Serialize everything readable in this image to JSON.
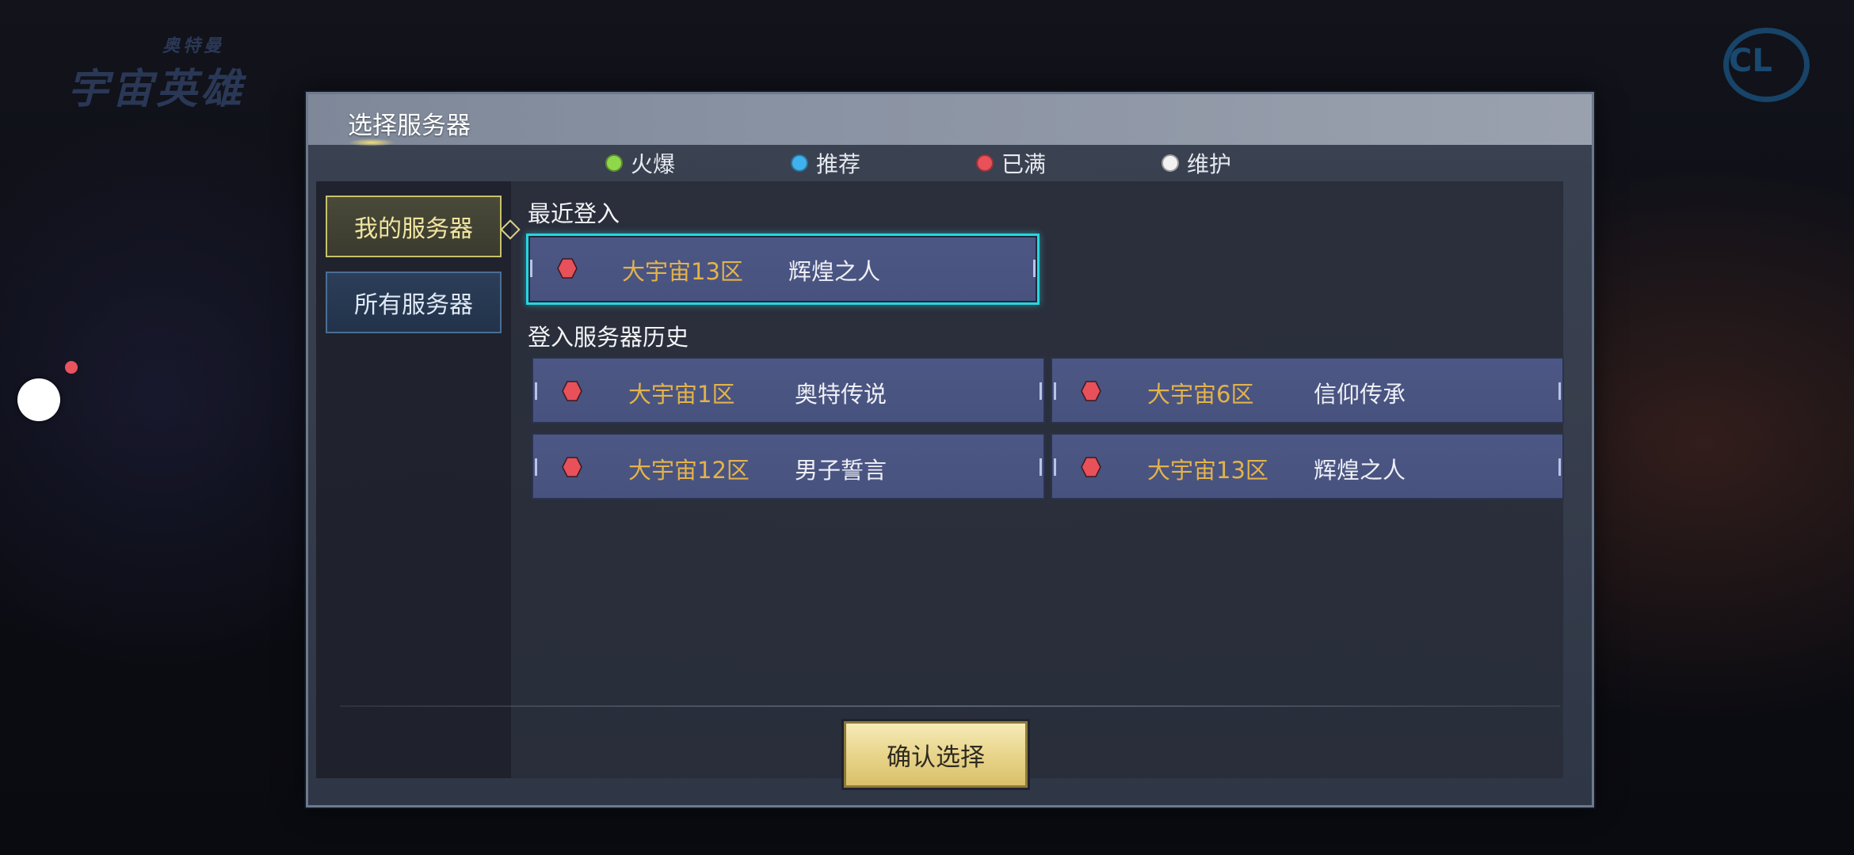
{
  "dialog": {
    "title": "选择服务器",
    "confirm_label": "确认选择"
  },
  "legend": [
    {
      "label": "火爆",
      "color": "#8fd84a"
    },
    {
      "label": "推荐",
      "color": "#3fb2ee"
    },
    {
      "label": "已满",
      "color": "#e8505a"
    },
    {
      "label": "维护",
      "color": "#f2f2f2"
    }
  ],
  "tabs": {
    "my_servers": "我的服务器",
    "all_servers": "所有服务器"
  },
  "recent": {
    "label": "最近登入",
    "server": {
      "zone": "大宇宙13区",
      "name": "辉煌之人",
      "status_color": "#e8505a"
    }
  },
  "history": {
    "label": "登入服务器历史",
    "servers": [
      {
        "zone": "大宇宙1区",
        "name": "奥特传说",
        "status_color": "#e8505a"
      },
      {
        "zone": "大宇宙6区",
        "name": "信仰传承",
        "status_color": "#e8505a"
      },
      {
        "zone": "大宇宙12区",
        "name": "男子誓言",
        "status_color": "#e8505a"
      },
      {
        "zone": "大宇宙13区",
        "name": "辉煌之人",
        "status_color": "#e8505a"
      }
    ]
  }
}
